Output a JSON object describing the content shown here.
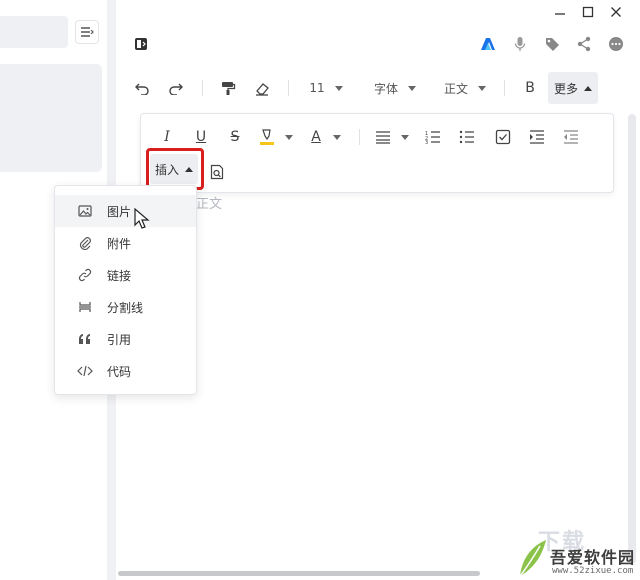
{
  "window": {
    "controls": {
      "minimize": "minimize",
      "maximize": "maximize",
      "close": "close"
    }
  },
  "top_icons": [
    "sidebar-toggle-icon",
    "app-logo-icon",
    "microphone-icon",
    "tag-icon",
    "share-icon",
    "more-circle-icon"
  ],
  "toolbar": {
    "undo": "undo",
    "redo": "redo",
    "format_painter": "format-painter",
    "eraser": "clear-format",
    "font_size": "11",
    "font_family": "字体",
    "paragraph_style": "正文",
    "bold": "B",
    "more_label": "更多"
  },
  "format_panel": {
    "italic": "I",
    "underline": "U",
    "strike": "S",
    "font_color": "A",
    "insert_label": "插入"
  },
  "editor": {
    "placeholder": "正文"
  },
  "insert_menu": {
    "items": [
      {
        "label": "图片",
        "icon": "image-icon"
      },
      {
        "label": "附件",
        "icon": "paperclip-icon"
      },
      {
        "label": "链接",
        "icon": "link-icon"
      },
      {
        "label": "分割线",
        "icon": "divider-icon"
      },
      {
        "label": "引用",
        "icon": "quote-icon"
      },
      {
        "label": "代码",
        "icon": "code-icon"
      }
    ],
    "hovered_index": 0
  },
  "watermark": {
    "title": "吾爱软件园",
    "url": "www.52zixue.com",
    "ghost": "下载"
  },
  "colors": {
    "highlight_red": "#d81e1e",
    "accent_blue": "#1a73e8",
    "highlighter_yellow": "#f5c518"
  }
}
